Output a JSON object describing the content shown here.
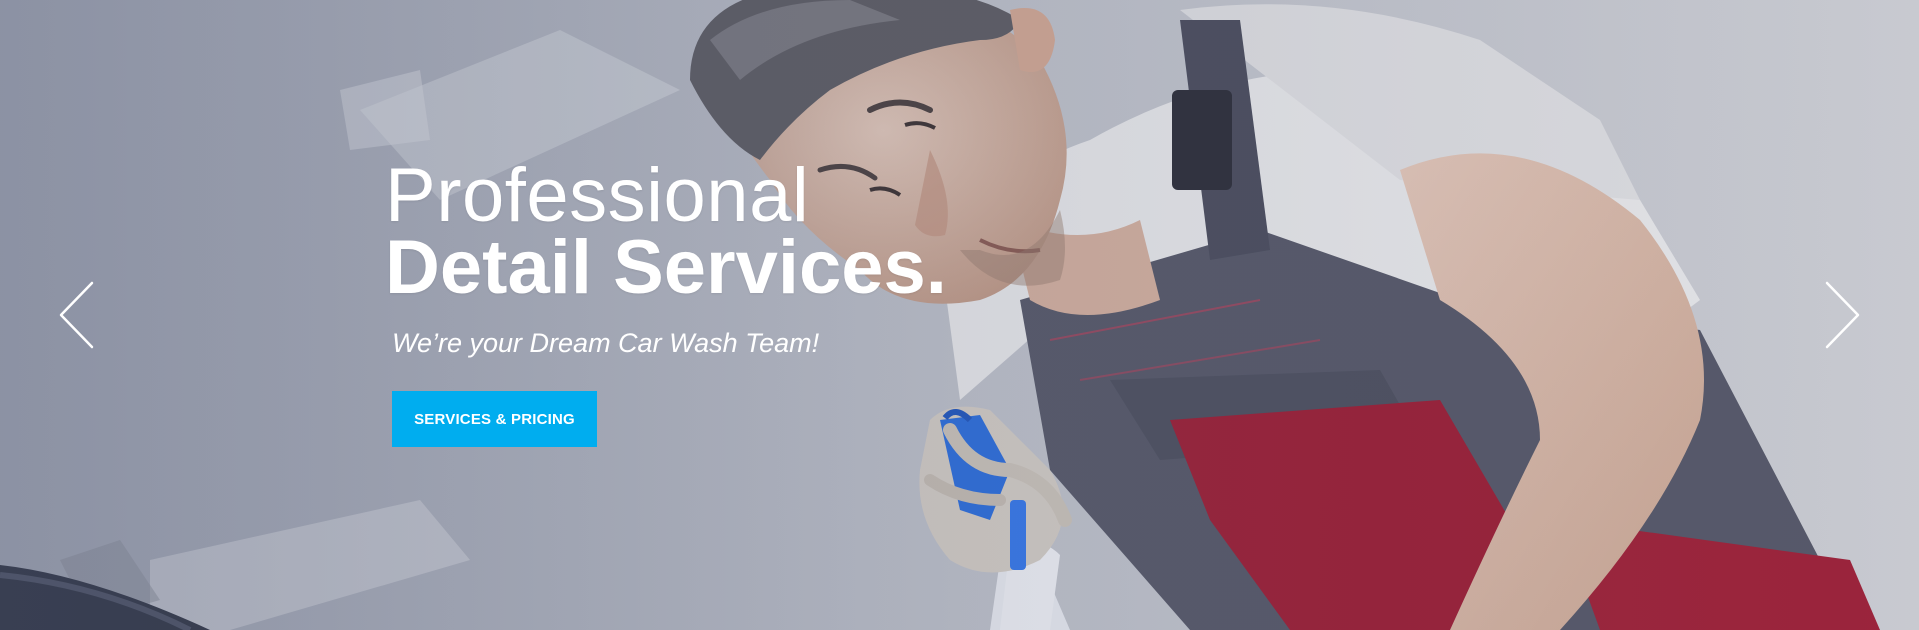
{
  "hero": {
    "headline_line1": "Professional",
    "headline_line2": "Detail Services.",
    "subtitle": "We’re your Dream Car Wash Team!",
    "cta_label": "SERVICES & PRICING"
  },
  "slider": {
    "prev_icon": "chevron-left-icon",
    "next_icon": "chevron-right-icon"
  },
  "colors": {
    "accent": "#00adef",
    "text": "#ffffff"
  }
}
